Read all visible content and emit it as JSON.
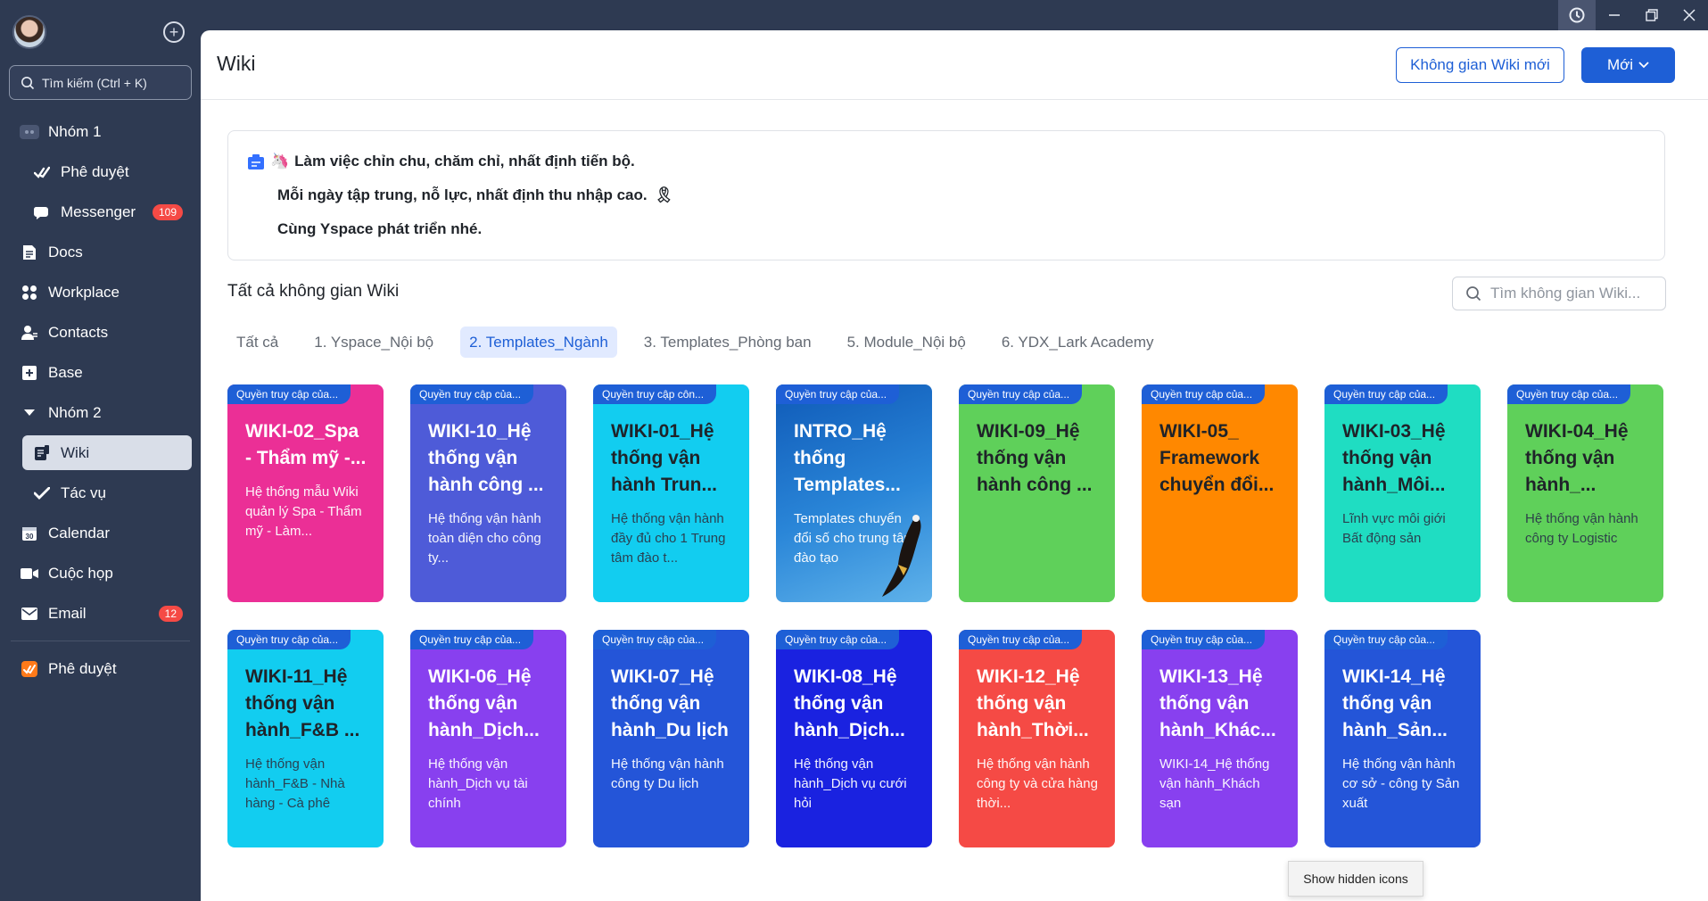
{
  "window": {
    "controls": [
      "history-icon",
      "minimize-icon",
      "restore-icon",
      "close-icon"
    ]
  },
  "sidebar": {
    "search_placeholder": "Tìm kiếm (Ctrl + K)",
    "items": [
      {
        "label": "Nhóm 1",
        "icon": "group-icon"
      },
      {
        "label": "Phê duyệt",
        "icon": "approval-icon"
      },
      {
        "label": "Messenger",
        "icon": "messenger-icon",
        "badge": "109"
      },
      {
        "label": "Docs",
        "icon": "docs-icon"
      },
      {
        "label": "Workplace",
        "icon": "workplace-icon"
      },
      {
        "label": "Contacts",
        "icon": "contacts-icon"
      },
      {
        "label": "Base",
        "icon": "base-icon"
      },
      {
        "label": "Nhóm 2",
        "icon": "chevron-down-icon"
      },
      {
        "label": "Wiki",
        "icon": "wiki-icon"
      },
      {
        "label": "Tác vụ",
        "icon": "task-icon"
      },
      {
        "label": "Calendar",
        "icon": "calendar-icon",
        "day": "30"
      },
      {
        "label": "Cuộc họp",
        "icon": "meeting-icon"
      },
      {
        "label": "Email",
        "icon": "email-icon",
        "badge": "12"
      },
      {
        "label": "Phê duyệt",
        "icon": "approval-app-icon"
      }
    ]
  },
  "header": {
    "title": "Wiki",
    "new_space_button": "Không gian Wiki mới",
    "new_button": "Mới"
  },
  "announcement": {
    "line1": "Làm việc chỉn chu, chăm chỉ, nhất định tiến bộ.",
    "line2": "Mỗi ngày tập trung, nỗ lực, nhất định thu nhập cao.",
    "line3": "Cùng Yspace phát triển nhé."
  },
  "spaces": {
    "title": "Tất cả không gian Wiki",
    "search_placeholder": "Tìm không gian Wiki...",
    "tabs": [
      "Tất cả",
      "1. Yspace_Nội bộ",
      "2. Templates_Ngành",
      "3. Templates_Phòng ban",
      "5. Module_Nội bộ",
      "6. YDX_Lark Academy"
    ],
    "active_tab": "2. Templates_Ngành"
  },
  "cards": [
    {
      "access": "Quyền truy cập của...",
      "title": "WIKI-02_Spa - Thẩm mỹ -...",
      "desc": "Hệ thống mẫu Wiki quản lý Spa - Thẩm mỹ - Làm...",
      "color": "#eb2f96"
    },
    {
      "access": "Quyền truy cập của...",
      "title": "WIKI-10_Hệ thống vận hành công ...",
      "desc": "Hệ thống vận hành toàn diện cho công ty...",
      "color": "#4e5bd8"
    },
    {
      "access": "Quyền truy cập côn...",
      "title": "WIKI-01_Hệ thống vận hành Trun...",
      "desc": "Hệ thống vận hành đầy đủ cho 1 Trung tâm đào t...",
      "color": "#12cdf0"
    },
    {
      "access": "Quyền truy cập của...",
      "title": "INTRO_Hệ thống Templates...",
      "desc": "Templates chuyển đổi số cho trung tâm đào tạo",
      "color": "#1a6ec9"
    },
    {
      "access": "Quyền truy cập của...",
      "title": "WIKI-09_Hệ thống vận hành công ...",
      "desc": "",
      "color": "#5fd05a"
    },
    {
      "access": "Quyền truy cập của...",
      "title": "WIKI-05_ Framework chuyển đổi...",
      "desc": "",
      "color": "#ff8800"
    },
    {
      "access": "Quyền truy cập của...",
      "title": "WIKI-03_Hệ thống vận hành_Môi...",
      "desc": "Lĩnh vực môi giới Bất động sản",
      "color": "#1fddc2"
    },
    {
      "access": "Quyền truy cập của...",
      "title": "WIKI-04_Hệ thống vận hành_...",
      "desc": "Hệ thống vận hành công ty Logistic",
      "color": "#5fd05a"
    },
    {
      "access": "Quyền truy cập của...",
      "title": "WIKI-11_Hệ thống vận hành_F&B ...",
      "desc": "Hệ thống vận hành_F&B - Nhà hàng - Cà phê",
      "color": "#12cdf0"
    },
    {
      "access": "Quyền truy cập của...",
      "title": "WIKI-06_Hệ thống vận hành_Dịch...",
      "desc": "Hệ thống vận hành_Dịch vụ tài chính",
      "color": "#8840ef"
    },
    {
      "access": "Quyền truy cập của...",
      "title": "WIKI-07_Hệ thống vận hành_Du lịch",
      "desc": "Hệ thống vận hành công ty Du lịch",
      "color": "#2455d8"
    },
    {
      "access": "Quyền truy cập của...",
      "title": "WIKI-08_Hệ thống vận hành_Dịch...",
      "desc": "Hệ thống vận hành_Dịch vụ cưới hỏi",
      "color": "#1a22e0"
    },
    {
      "access": "Quyền truy cập của...",
      "title": "WIKI-12_Hệ thống vận hành_Thời...",
      "desc": "Hệ thống vận hành công ty và cửa hàng thời...",
      "color": "#f54a45"
    },
    {
      "access": "Quyền truy cập của...",
      "title": "WIKI-13_Hệ thống vận hành_Khác...",
      "desc": "WIKI-14_Hệ thống vận hành_Khách sạn",
      "color": "#8840ef"
    },
    {
      "access": "Quyền truy cập của...",
      "title": "WIKI-14_Hệ thống vận hành_Sản...",
      "desc": "Hệ thống vận hành cơ sở - công ty Sản xuất",
      "color": "#2455d8"
    }
  ],
  "tooltip": "Show hidden icons"
}
